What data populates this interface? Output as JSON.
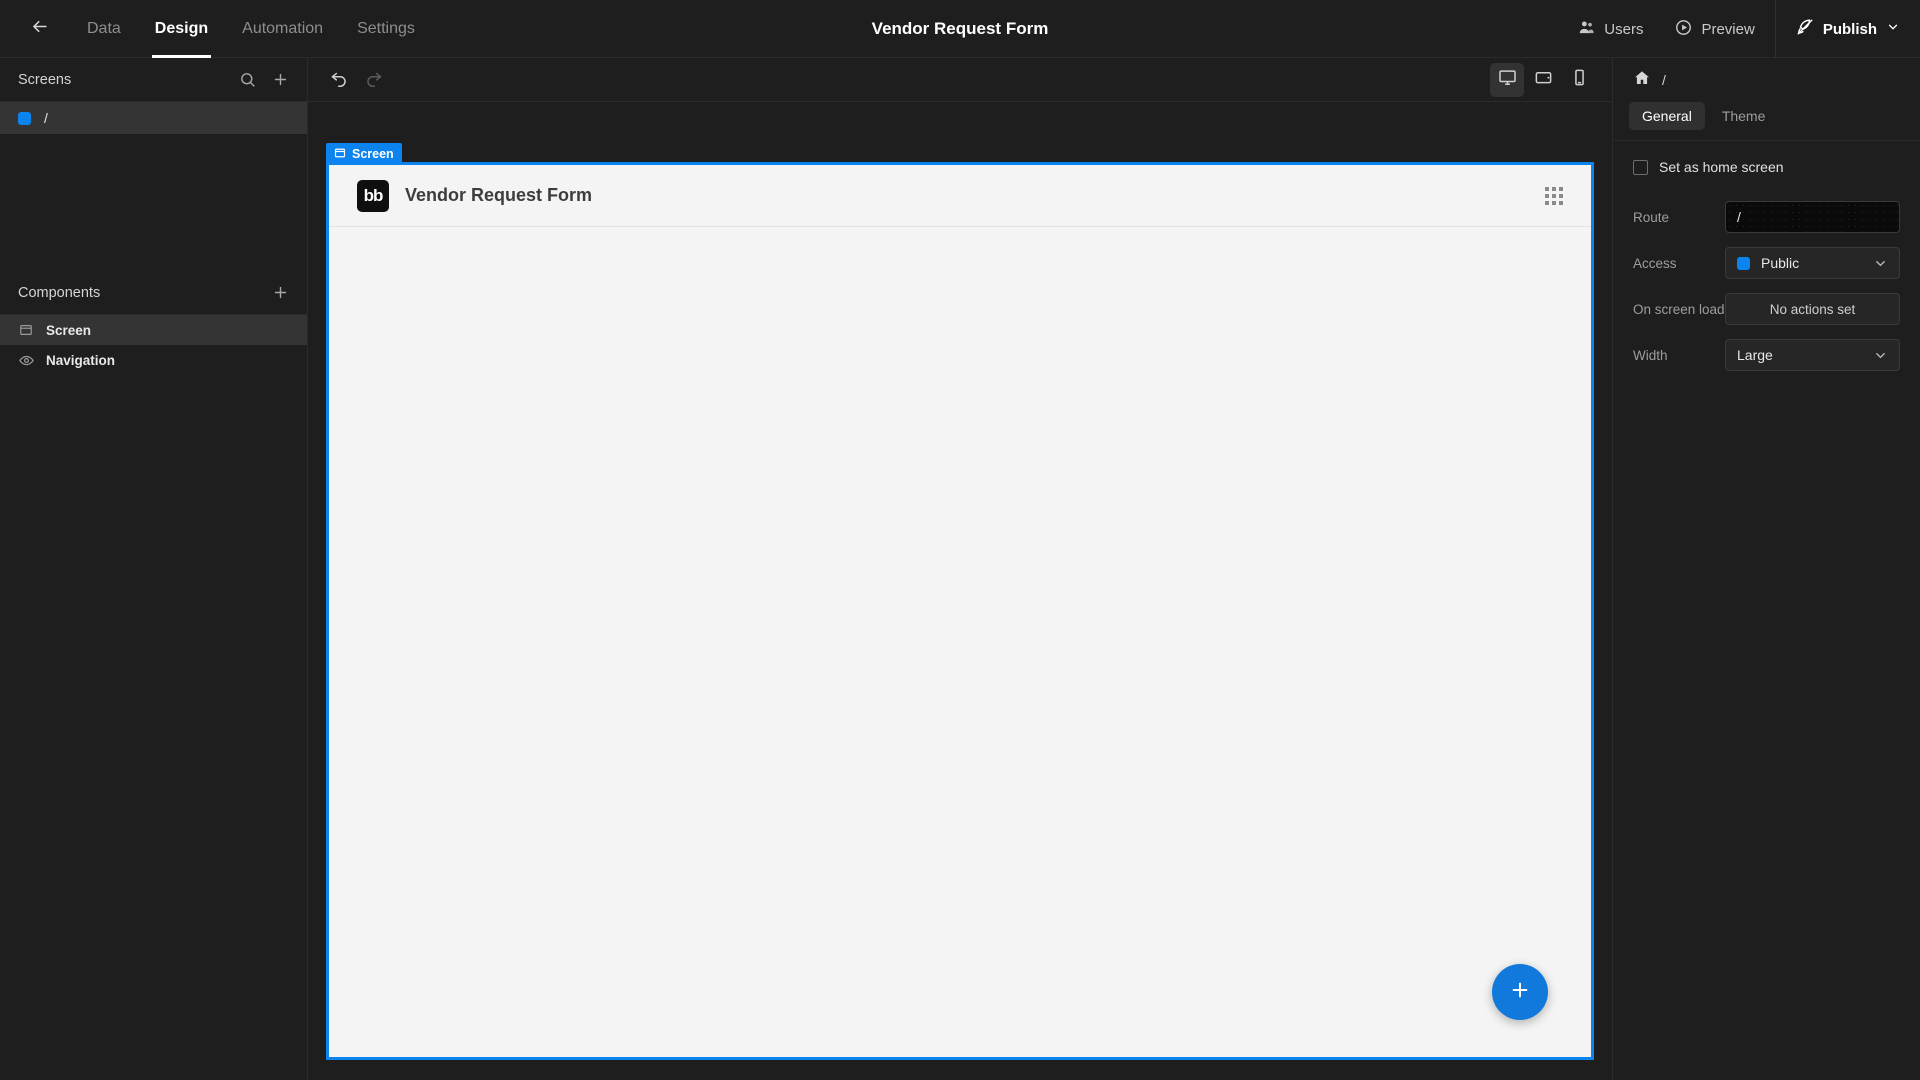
{
  "topbar": {
    "back_icon": "arrow-left-icon",
    "tabs": [
      {
        "label": "Data",
        "active": false
      },
      {
        "label": "Design",
        "active": true
      },
      {
        "label": "Automation",
        "active": false
      },
      {
        "label": "Settings",
        "active": false
      }
    ],
    "app_title": "Vendor Request Form",
    "users_label": "Users",
    "users_icon": "users-icon",
    "preview_label": "Preview",
    "preview_icon": "play-circle-icon",
    "publish_label": "Publish",
    "publish_icon": "rocket-icon",
    "publish_chevron_icon": "chevron-down-icon"
  },
  "sidebar": {
    "screens": {
      "title": "Screens",
      "search_icon": "search-icon",
      "add_icon": "plus-icon",
      "items": [
        {
          "label": "/",
          "selected": true,
          "badge_color": "#0b84ef"
        }
      ]
    },
    "components": {
      "title": "Components",
      "add_icon": "plus-icon",
      "items": [
        {
          "label": "Screen",
          "icon": "window-icon",
          "selected": true
        },
        {
          "label": "Navigation",
          "icon": "eye-icon",
          "selected": false
        }
      ]
    }
  },
  "canvas": {
    "undo_icon": "undo-icon",
    "redo_icon": "redo-icon",
    "devices": [
      {
        "name": "desktop",
        "icon": "desktop-icon",
        "active": true
      },
      {
        "name": "tablet",
        "icon": "tablet-icon",
        "active": false
      },
      {
        "name": "mobile",
        "icon": "mobile-icon",
        "active": false
      }
    ],
    "screen_tag_label": "Screen",
    "screen_tag_icon": "window-icon",
    "screen_tag_color": "#0b84ef",
    "app_logo_text": "bb",
    "app_nav_title": "Vendor Request Form",
    "drag_handle_icon": "grid-dots-icon",
    "fab_icon": "plus-icon",
    "fab_color": "#1178dc"
  },
  "rightpanel": {
    "breadcrumb_home_icon": "home-icon",
    "breadcrumb_path": "/",
    "tabs": [
      {
        "label": "General",
        "active": true
      },
      {
        "label": "Theme",
        "active": false
      }
    ],
    "home_screen_checkbox_label": "Set as home screen",
    "home_screen_checked": false,
    "fields": {
      "route_label": "Route",
      "route_value": "/",
      "access_label": "Access",
      "access_value": "Public",
      "access_badge_color": "#0b84ef",
      "onload_label": "On screen load",
      "onload_value": "No actions set",
      "width_label": "Width",
      "width_value": "Large",
      "chevron_icon": "chevron-down-icon"
    }
  }
}
